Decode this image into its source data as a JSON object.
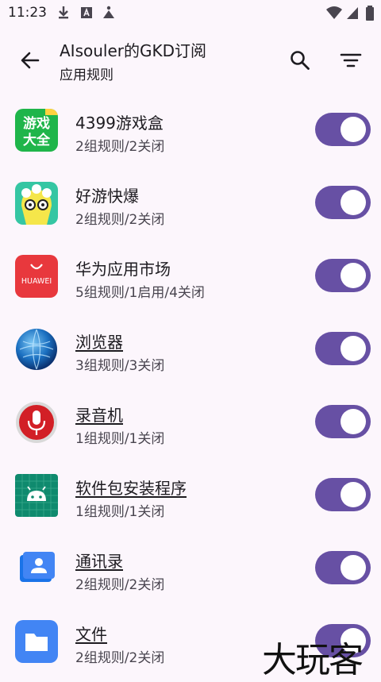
{
  "status_bar": {
    "time": "11:23"
  },
  "header": {
    "title": "AIsouler的GKD订阅",
    "subtitle": "应用规则"
  },
  "icons": {
    "back": "arrow-back-icon",
    "search": "search-icon",
    "sort": "sort-icon"
  },
  "apps": [
    {
      "name": "4399游戏盒",
      "rules": "2组规则/2关闭",
      "icon": "4399-game-box-icon",
      "icon_text": "游戏\n大全",
      "enabled": true
    },
    {
      "name": "好游快爆",
      "rules": "2组规则/2关闭",
      "icon": "haoyou-kuaibao-icon",
      "enabled": true
    },
    {
      "name": "华为应用市场",
      "rules": "5组规则/1启用/4关闭",
      "icon": "huawei-appgallery-icon",
      "icon_text": "HUAWEI",
      "enabled": true
    },
    {
      "name": "浏览器",
      "rules": "3组规则/3关闭",
      "icon": "browser-globe-icon",
      "enabled": true
    },
    {
      "name": "录音机",
      "rules": "1组规则/1关闭",
      "icon": "recorder-microphone-icon",
      "enabled": true
    },
    {
      "name": "软件包安装程序",
      "rules": "1组规则/1关闭",
      "icon": "package-installer-android-icon",
      "enabled": true
    },
    {
      "name": "通讯录",
      "rules": "2组规则/2关闭",
      "icon": "contacts-icon",
      "enabled": true
    },
    {
      "name": "文件",
      "rules": "2组规则/2关闭",
      "icon": "files-folder-icon",
      "enabled": true
    }
  ],
  "watermark": "大玩客",
  "colors": {
    "accent": "#6750a4",
    "background": "#fcf6fc"
  }
}
